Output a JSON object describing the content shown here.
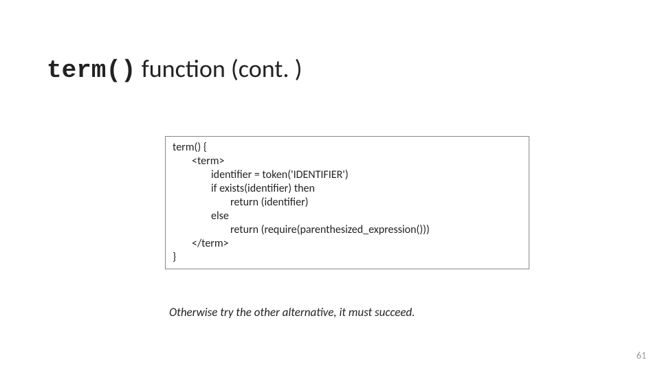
{
  "title": {
    "mono": "term()",
    "rest": " function (cont. )"
  },
  "code": {
    "l0": "term() {",
    "l1": "<term>",
    "l2": "identifier = token('IDENTIFIER')",
    "l3": "if exists(identifier) then",
    "l4": "return (identifier)",
    "l5": "else",
    "l6": "return (require(parenthesized_expression()))",
    "l7": "</term>",
    "l8": "}"
  },
  "note": "Otherwise try the other alternative, it must succeed.",
  "pagenum": "61"
}
